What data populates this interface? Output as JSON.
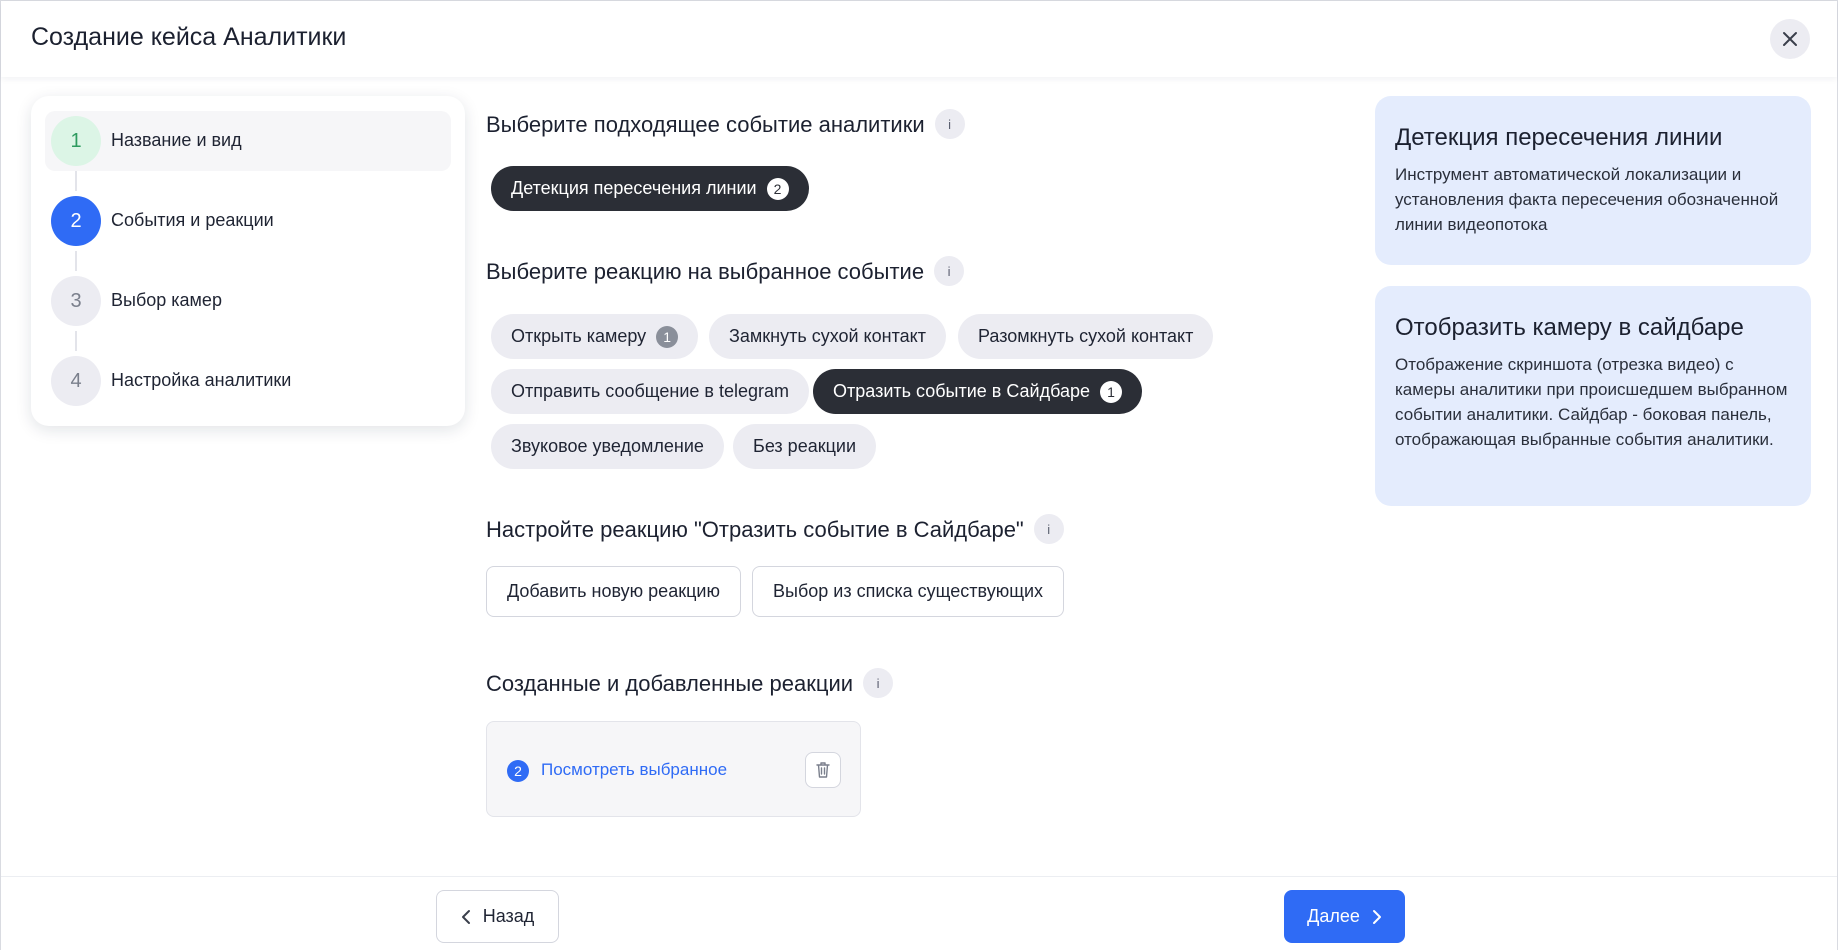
{
  "window": {
    "title": "Создание кейса Аналитики"
  },
  "stepper": {
    "steps": [
      {
        "number": "1",
        "label": "Название и вид",
        "state": "done"
      },
      {
        "number": "2",
        "label": "События и реакции",
        "state": "current"
      },
      {
        "number": "3",
        "label": "Выбор камер",
        "state": "pending"
      },
      {
        "number": "4",
        "label": "Настройка аналитики",
        "state": "pending"
      }
    ]
  },
  "events": {
    "title": "Выберите подходящее событие аналитики",
    "info": "i",
    "chips": [
      {
        "label": "Детекция пересечения линии",
        "badge": "2",
        "selected": true
      }
    ]
  },
  "reactions": {
    "title": "Выберите реакцию на выбранное событие",
    "info": "i",
    "chips": [
      {
        "label": "Открыть камеру",
        "badge": "1",
        "selected": false
      },
      {
        "label": "Замкнуть сухой контакт",
        "badge": "",
        "selected": false
      },
      {
        "label": "Разомкнуть сухой контакт",
        "badge": "",
        "selected": false
      },
      {
        "label": "Отправить сообщение в telegram",
        "badge": "",
        "selected": false
      },
      {
        "label": "Отразить событие в Сайдбаре",
        "badge": "1",
        "selected": true
      },
      {
        "label": "Звуковое уведомление",
        "badge": "",
        "selected": false
      },
      {
        "label": "Без реакции",
        "badge": "",
        "selected": false
      }
    ]
  },
  "configure": {
    "title": "Настройте реакцию \"Отразить событие в Сайдбаре\"",
    "info": "i",
    "add_label": "Добавить новую реакцию",
    "choose_label": "Выбор из списка существующих"
  },
  "created": {
    "title": "Созданные и добавленные реакции",
    "info": "i",
    "count": "2",
    "link_label": "Посмотреть выбранное"
  },
  "info_cards": [
    {
      "title": "Детекция пересечения линии",
      "text": "Инструмент автоматической локализации и установления факта пересечения обозначенной линии видеопотока"
    },
    {
      "title": "Отобразить камеру в сайдбаре",
      "text": "Отображение скриншота (отрезка видео) с камеры аналитики при происшедшем выбранном событии аналитики. Сайдбар - боковая панель, отображающая выбранные события аналитики."
    }
  ],
  "footer": {
    "back_label": "Назад",
    "next_label": "Далее"
  },
  "colors": {
    "accent": "#2f6bf5",
    "chip_dark": "#2b2e36",
    "chip_light": "#ececf2",
    "info_card_bg": "#e4ecfd",
    "step_done_bg": "#dcf5e6"
  },
  "icons": {
    "close": "close-icon",
    "info": "info-icon",
    "trash": "trash-icon",
    "chevron_left": "chevron-left-icon",
    "chevron_right": "chevron-right-icon"
  }
}
